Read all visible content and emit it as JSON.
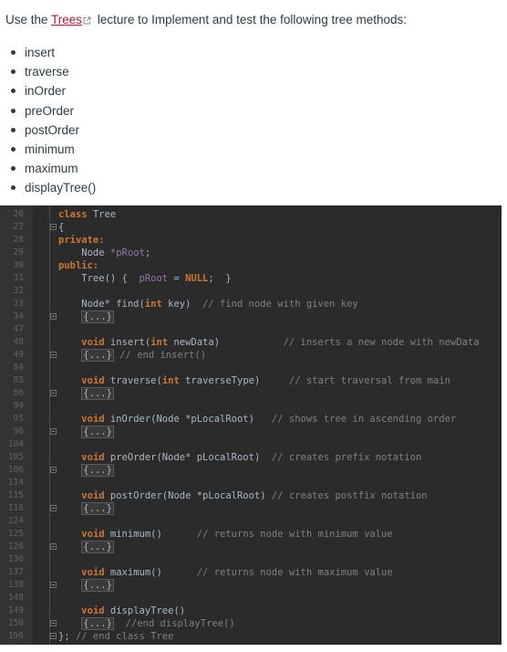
{
  "intro": {
    "before_link": "Use the ",
    "link": "Trees",
    "after_link": " lecture to Implement and test the following tree methods:"
  },
  "methods": [
    "insert",
    "traverse",
    "inOrder",
    "preOrder",
    "postOrder",
    "minimum",
    "maximum",
    "displayTree()"
  ],
  "code": {
    "lines": [
      {
        "num": "26",
        "fold": false,
        "segs": [
          [
            "k",
            "class"
          ],
          [
            "t",
            " Tree"
          ]
        ]
      },
      {
        "num": "27",
        "fold": true,
        "segs": [
          [
            "t",
            "{"
          ]
        ]
      },
      {
        "num": "28",
        "fold": false,
        "segs": [
          [
            "k",
            "private:"
          ]
        ]
      },
      {
        "num": "29",
        "fold": false,
        "segs": [
          [
            "t",
            "    Node "
          ],
          [
            "m",
            "*pRoot"
          ],
          [
            "t",
            ";"
          ]
        ]
      },
      {
        "num": "30",
        "fold": false,
        "segs": [
          [
            "k",
            "public:"
          ]
        ]
      },
      {
        "num": "31",
        "fold": false,
        "segs": [
          [
            "t",
            "    Tree() {  "
          ],
          [
            "m",
            "pRoot"
          ],
          [
            "t",
            " = "
          ],
          [
            "k",
            "NULL"
          ],
          [
            "t",
            ";  }"
          ]
        ]
      },
      {
        "num": "32",
        "fold": false,
        "segs": []
      },
      {
        "num": "33",
        "fold": false,
        "segs": [
          [
            "t",
            "    Node* find("
          ],
          [
            "k",
            "int"
          ],
          [
            "t",
            " key)  "
          ],
          [
            "c",
            "// find node with given key"
          ]
        ]
      },
      {
        "num": "34",
        "fold": true,
        "segs": [
          [
            "t",
            "    "
          ],
          [
            "f",
            "{...}"
          ]
        ]
      },
      {
        "num": "47",
        "fold": false,
        "segs": []
      },
      {
        "num": "48",
        "fold": false,
        "segs": [
          [
            "t",
            "    "
          ],
          [
            "k",
            "void"
          ],
          [
            "t",
            " insert("
          ],
          [
            "k",
            "int"
          ],
          [
            "t",
            " newData)           "
          ],
          [
            "c",
            "// inserts a new node with newData"
          ]
        ]
      },
      {
        "num": "49",
        "fold": true,
        "segs": [
          [
            "t",
            "    "
          ],
          [
            "f",
            "{...}"
          ],
          [
            "t",
            " "
          ],
          [
            "c",
            "// end insert()"
          ]
        ]
      },
      {
        "num": "84",
        "fold": false,
        "segs": []
      },
      {
        "num": "85",
        "fold": false,
        "segs": [
          [
            "t",
            "    "
          ],
          [
            "k",
            "void"
          ],
          [
            "t",
            " traverse("
          ],
          [
            "k",
            "int"
          ],
          [
            "t",
            " traverseType)     "
          ],
          [
            "c",
            "// start traversal from main"
          ]
        ]
      },
      {
        "num": "86",
        "fold": true,
        "segs": [
          [
            "t",
            "    "
          ],
          [
            "f",
            "{...}"
          ]
        ]
      },
      {
        "num": "94",
        "fold": false,
        "segs": []
      },
      {
        "num": "95",
        "fold": false,
        "segs": [
          [
            "t",
            "    "
          ],
          [
            "k",
            "void"
          ],
          [
            "t",
            " inOrder(Node *pLocalRoot)   "
          ],
          [
            "c",
            "// shows tree in ascending order"
          ]
        ]
      },
      {
        "num": "96",
        "fold": true,
        "segs": [
          [
            "t",
            "    "
          ],
          [
            "f",
            "{...}"
          ]
        ]
      },
      {
        "num": "104",
        "fold": false,
        "segs": []
      },
      {
        "num": "105",
        "fold": false,
        "segs": [
          [
            "t",
            "    "
          ],
          [
            "k",
            "void"
          ],
          [
            "t",
            " preOrder(Node* pLocalRoot)  "
          ],
          [
            "c",
            "// creates prefix notation"
          ]
        ]
      },
      {
        "num": "106",
        "fold": true,
        "segs": [
          [
            "t",
            "    "
          ],
          [
            "f",
            "{...}"
          ]
        ]
      },
      {
        "num": "114",
        "fold": false,
        "segs": []
      },
      {
        "num": "115",
        "fold": false,
        "segs": [
          [
            "t",
            "    "
          ],
          [
            "k",
            "void"
          ],
          [
            "t",
            " postOrder(Node *pLocalRoot) "
          ],
          [
            "c",
            "// creates postfix notation"
          ]
        ]
      },
      {
        "num": "116",
        "fold": true,
        "segs": [
          [
            "t",
            "    "
          ],
          [
            "f",
            "{...}"
          ]
        ]
      },
      {
        "num": "124",
        "fold": false,
        "segs": []
      },
      {
        "num": "125",
        "fold": false,
        "segs": [
          [
            "t",
            "    "
          ],
          [
            "k",
            "void"
          ],
          [
            "t",
            " minimum()      "
          ],
          [
            "c",
            "// returns node with minimum value"
          ]
        ]
      },
      {
        "num": "126",
        "fold": true,
        "segs": [
          [
            "t",
            "    "
          ],
          [
            "f",
            "{...}"
          ]
        ]
      },
      {
        "num": "136",
        "fold": false,
        "segs": []
      },
      {
        "num": "137",
        "fold": false,
        "segs": [
          [
            "t",
            "    "
          ],
          [
            "k",
            "void"
          ],
          [
            "t",
            " maximum()      "
          ],
          [
            "c",
            "// returns node with maximum value"
          ]
        ]
      },
      {
        "num": "138",
        "fold": true,
        "segs": [
          [
            "t",
            "    "
          ],
          [
            "f",
            "{...}"
          ]
        ]
      },
      {
        "num": "148",
        "fold": false,
        "segs": []
      },
      {
        "num": "149",
        "fold": false,
        "segs": [
          [
            "t",
            "    "
          ],
          [
            "k",
            "void"
          ],
          [
            "t",
            " displayTree()"
          ]
        ]
      },
      {
        "num": "150",
        "fold": true,
        "segs": [
          [
            "t",
            "    "
          ],
          [
            "f",
            "{...}"
          ],
          [
            "t",
            "  "
          ],
          [
            "c",
            "//end displayTree()"
          ]
        ]
      },
      {
        "num": "196",
        "fold": true,
        "segs": [
          [
            "t",
            "}; "
          ],
          [
            "c",
            "// end class Tree"
          ]
        ]
      }
    ]
  }
}
